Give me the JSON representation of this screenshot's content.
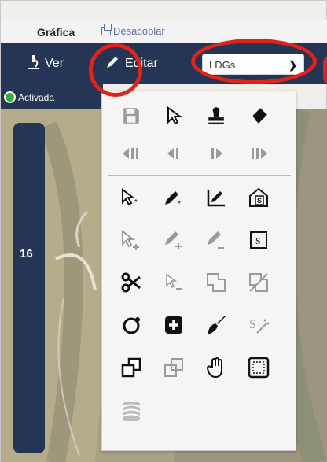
{
  "header": {
    "title": "Gráfica",
    "undock_label": "Desacoplar"
  },
  "toolbar": {
    "view_label": "Ver",
    "edit_label": "Editar",
    "layer_select_value": "LDGs"
  },
  "status": {
    "label": "Activada"
  },
  "map": {
    "scale_level": "16"
  },
  "edit_menu": {
    "icons": [
      [
        "save-icon",
        "select-arrow-icon",
        "stamp-icon",
        "eraser-icon"
      ],
      [
        "first-icon",
        "previous-icon",
        "next-icon",
        "last-icon"
      ],
      [
        "select-multiple-icon",
        "edit-multiple-icon",
        "edit-angle-icon",
        "house-selection-icon"
      ],
      [
        "select-add-icon",
        "edit-add-icon",
        "edit-subtract-icon",
        "snap-s-icon"
      ],
      [
        "scissors-icon",
        "select-subtract-icon",
        "union-icon",
        "cross-out-icon"
      ],
      [
        "circle-icon",
        "plus-box-icon",
        "brush-icon",
        "s-wand-icon"
      ],
      [
        "layer-front-icon",
        "layer-back-icon",
        "hand-icon",
        "dashed-square-icon"
      ],
      [
        "hatch-icon"
      ]
    ]
  },
  "colors": {
    "toolbar_bg": "#253556",
    "status_green": "#2fb23f",
    "highlight_red": "#e2231a"
  }
}
